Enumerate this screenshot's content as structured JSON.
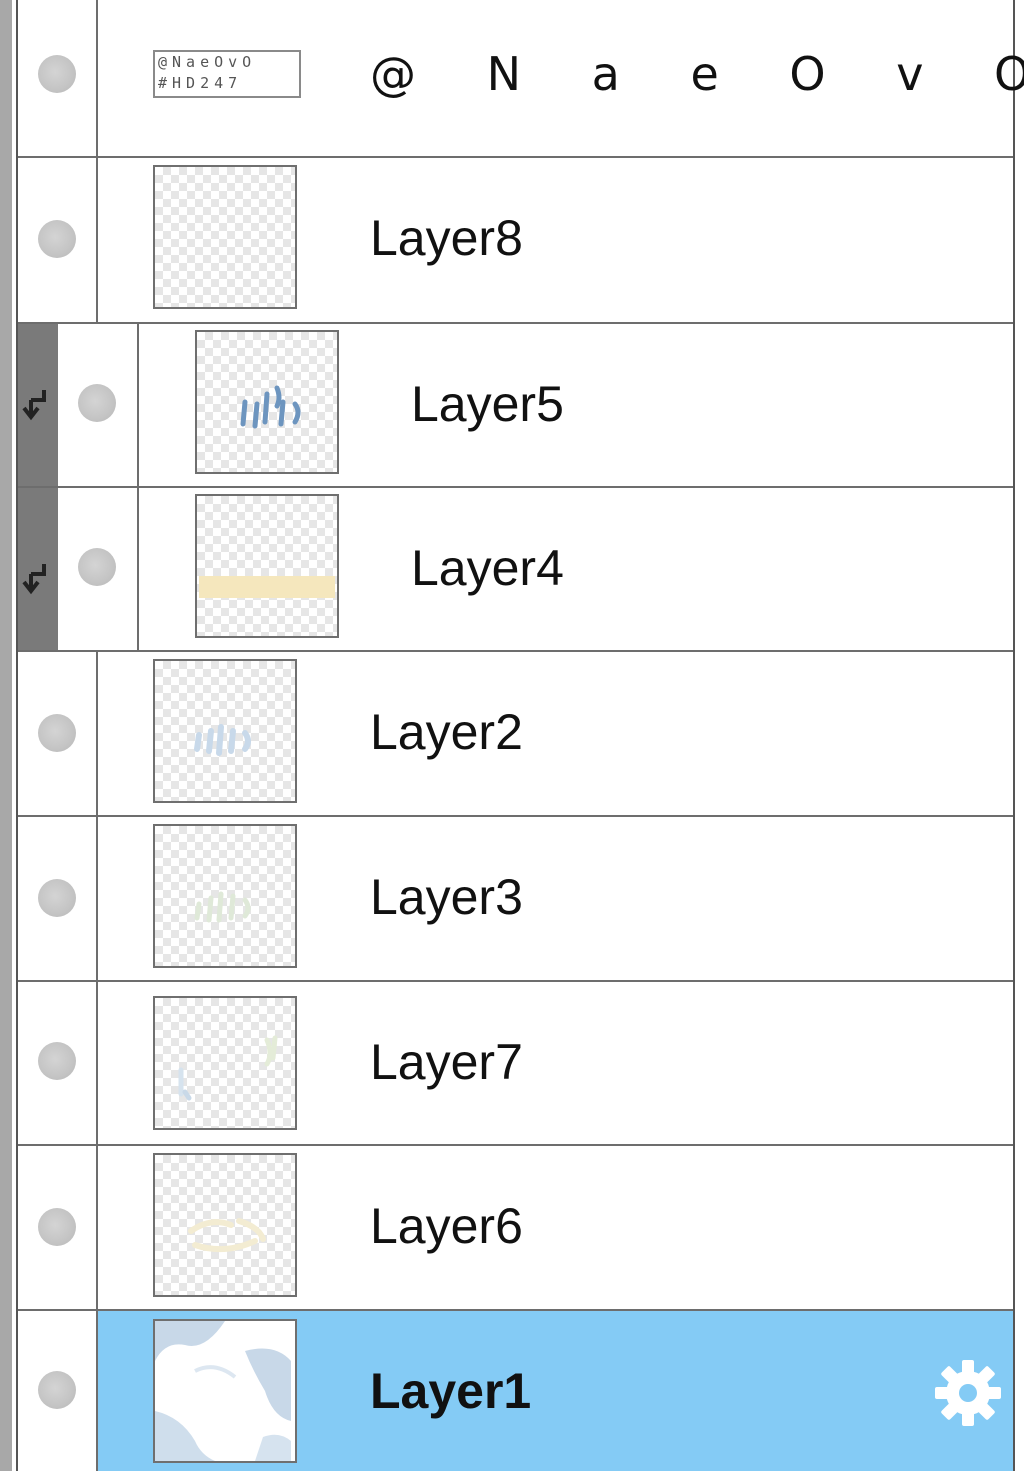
{
  "layers": [
    {
      "name": "@NaeOvO",
      "display": "@ N a e O v O",
      "kind": "text",
      "thumb_lines": [
        "@NaeOvO",
        "#HD247"
      ],
      "clipped": false,
      "selected": false
    },
    {
      "name": "Layer8",
      "display": "Layer8",
      "kind": "raster",
      "clipped": false,
      "selected": false
    },
    {
      "name": "Layer5",
      "display": "Layer5",
      "kind": "raster",
      "clipped": true,
      "selected": false
    },
    {
      "name": "Layer4",
      "display": "Layer4",
      "kind": "raster",
      "clipped": true,
      "selected": false
    },
    {
      "name": "Layer2",
      "display": "Layer2",
      "kind": "raster",
      "clipped": false,
      "selected": false
    },
    {
      "name": "Layer3",
      "display": "Layer3",
      "kind": "raster",
      "clipped": false,
      "selected": false
    },
    {
      "name": "Layer7",
      "display": "Layer7",
      "kind": "raster",
      "clipped": false,
      "selected": false
    },
    {
      "name": "Layer6",
      "display": "Layer6",
      "kind": "raster",
      "clipped": false,
      "selected": false
    },
    {
      "name": "Layer1",
      "display": "Layer1",
      "kind": "raster",
      "clipped": false,
      "selected": true
    }
  ],
  "icons": {
    "visibility": "visibility-dot-icon",
    "clipping": "clipping-arrow-icon",
    "settings": "gear-icon"
  },
  "colors": {
    "selected_row": "#84cbf5",
    "clip_strip": "#7a7a7a"
  }
}
